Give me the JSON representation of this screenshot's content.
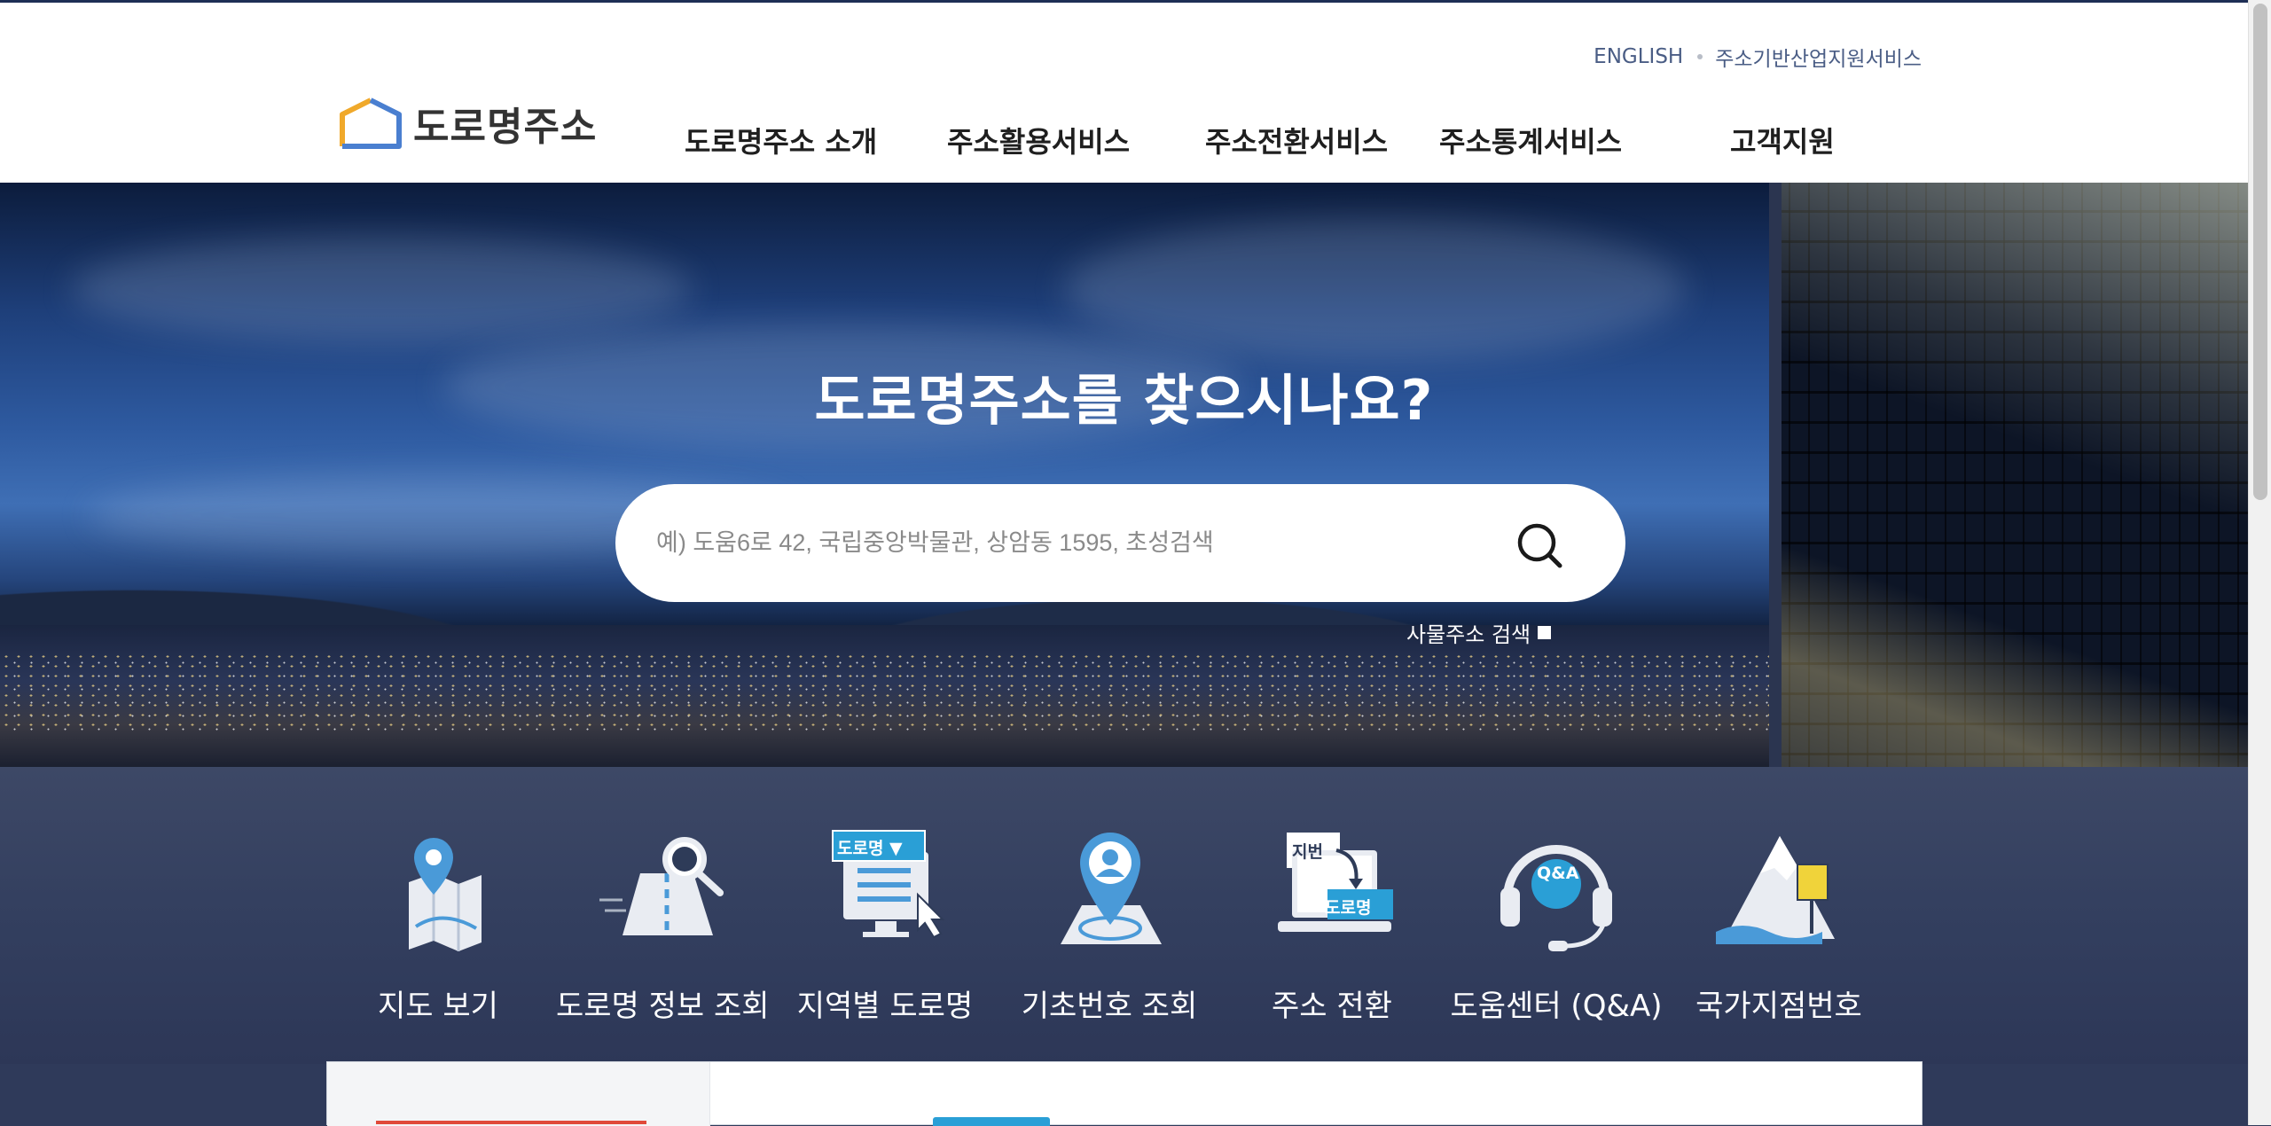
{
  "header": {
    "util_links": [
      "ENGLISH",
      "주소기반산업지원서비스"
    ],
    "logo_text": "도로명주소",
    "nav": [
      "도로명주소 소개",
      "주소활용서비스",
      "주소전환서비스",
      "주소통계서비스",
      "고객지원"
    ]
  },
  "hero": {
    "title": "도로명주소를 찾으시나요?",
    "search_placeholder": "예) 도움6로 42, 국립중앙박물관, 상암동 1595, 초성검색",
    "thing_search_label": "사물주소 검색"
  },
  "quick_menu": [
    {
      "label": "지도 보기",
      "icon": "map-pin-icon"
    },
    {
      "label": "도로명 정보 조회",
      "icon": "road-info-search-icon"
    },
    {
      "label": "지역별 도로명",
      "icon": "regional-road-list-icon"
    },
    {
      "label": "기초번호 조회",
      "icon": "base-number-location-icon"
    },
    {
      "label": "주소 전환",
      "icon": "address-conversion-icon"
    },
    {
      "label": "도움센터 (Q&A)",
      "icon": "headset-qa-icon"
    },
    {
      "label": "국가지점번호",
      "icon": "mountain-sign-icon"
    }
  ],
  "quick_icon_texts": {
    "road_badge": "도로명 ▼",
    "jibun": "지번",
    "doro": "도로명",
    "qa": "Q&A"
  },
  "colors": {
    "header_bg": "#ffffff",
    "hero_sky": "#2e5aa0",
    "quick_bg": "#333f5f",
    "icon_blue": "#2a9fd6"
  }
}
